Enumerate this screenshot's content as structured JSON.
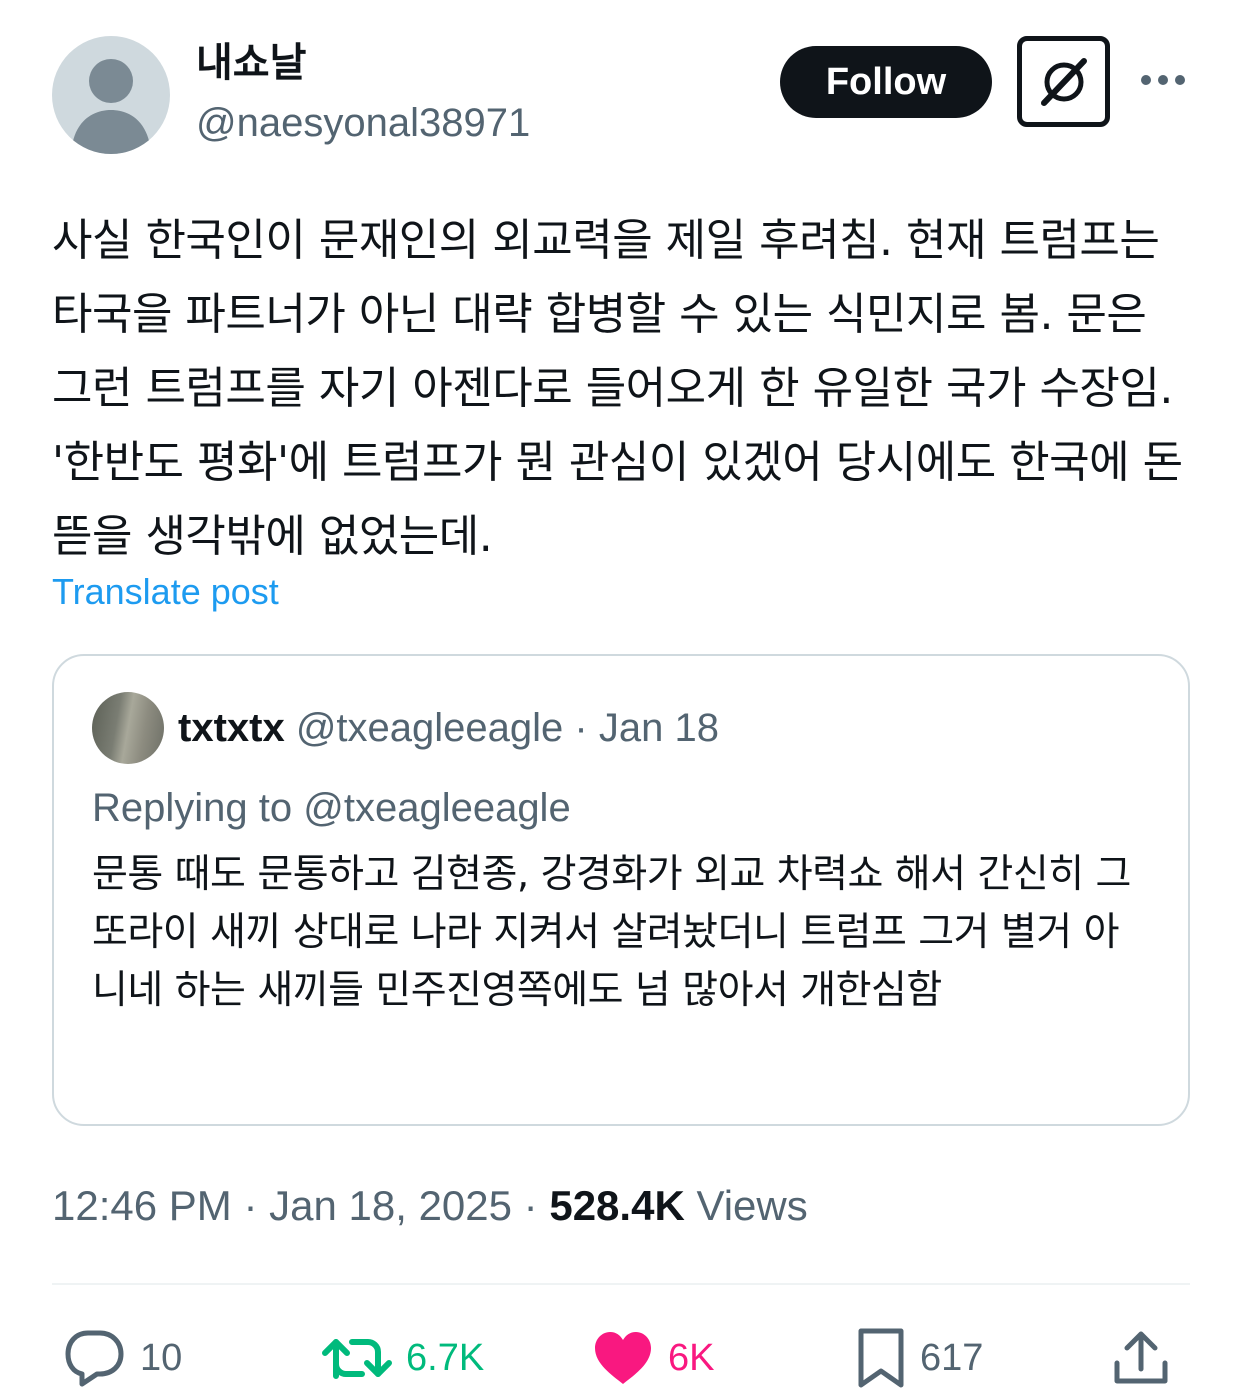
{
  "author": {
    "display_name": "내쇼날",
    "handle": "@naesyonal38971"
  },
  "header_actions": {
    "follow_label": "Follow",
    "grok_icon": "grok-icon",
    "more_icon": "more-icon"
  },
  "post": {
    "text": "사실 한국인이 문재인의 외교력을 제일 후려침. 현재 트럼프는 타국을 파트너가 아닌 대략 합병할 수 있는 식민지로 봄. 문은 그런 트럼프를 자기 아젠다로 들어오게 한 유일한 국가 수장임. '한반도 평화'에 트럼프가 뭔 관심이 있겠어 당시에도 한국에 돈 뜯을 생각밖에 없었는데.",
    "translate_label": "Translate post"
  },
  "quoted_post": {
    "display_name": "txtxtx",
    "handle": "@txeagleeagle",
    "separator": "·",
    "date": "Jan 18",
    "replying_to": "Replying to @txeagleeagle",
    "text": "문통 때도 문통하고 김현종, 강경화가 외교 차력쇼 해서 간신히 그 또라이 새끼 상대로 나라 지켜서 살려놨더니 트럼프 그거 별거 아니네 하는 새끼들 민주진영쪽에도 넘 많아서 개한심함"
  },
  "meta": {
    "time": "12:46 PM",
    "separator": "·",
    "date": "Jan 18, 2025",
    "views_count": "528.4K",
    "views_label": "Views"
  },
  "actions": {
    "reply_count": "10",
    "retweet_count": "6.7K",
    "like_count": "6K",
    "bookmark_count": "617"
  },
  "colors": {
    "link": "#1d9bf0",
    "retweet": "#00ba7c",
    "like": "#f91880",
    "secondary_text": "#536471",
    "primary_text": "#0f1419"
  }
}
